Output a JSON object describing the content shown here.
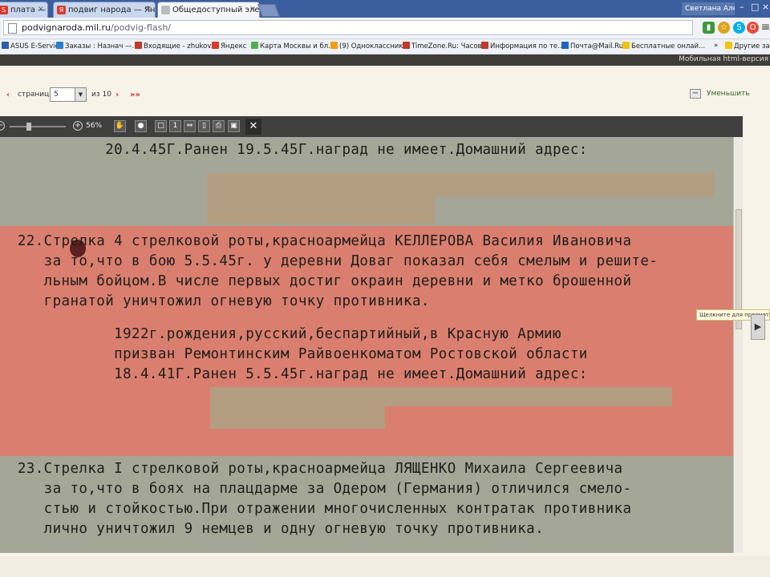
{
  "browser": {
    "tabs": [
      {
        "title": "плата — репетит",
        "icon": "S",
        "icon_color": "#d93a2b"
      },
      {
        "title": "подвиг народа — Яндекс",
        "icon": "Я",
        "icon_color": "#d93a2b"
      },
      {
        "title": "Общедоступный электрон",
        "icon": "",
        "icon_color": "#777777",
        "active": true
      }
    ],
    "user_name": "Светлана Алекс...",
    "address": {
      "host": "podvignaroda.mil.ru",
      "path": "/podvig-flash/"
    },
    "bookmarks": [
      {
        "label": "ASUS E-Service",
        "color": "#2b5bb5"
      },
      {
        "label": "Заказы : Назнач —...",
        "color": "#2a7fd4"
      },
      {
        "label": "Входящие - zhukov...",
        "color": "#c0392b"
      },
      {
        "label": "Яндекс",
        "color": "#d93a2b"
      },
      {
        "label": "Карта Москвы и бл...",
        "color": "#4caf50"
      },
      {
        "label": "(9) Одноклассники",
        "color": "#f39c12"
      },
      {
        "label": "TimeZone.Ru: Часов...",
        "color": "#c0392b"
      },
      {
        "label": "Информация по те...",
        "color": "#c0392b"
      },
      {
        "label": "Почта@Mail.Ru",
        "color": "#1e63c3"
      },
      {
        "label": "Бесплатные онлай...",
        "color": "#f1c40f"
      }
    ],
    "other_bookmarks": "Другие закладки",
    "bookmarks_more": "»"
  },
  "site": {
    "top_banner": "Мобильная html-версия"
  },
  "pager": {
    "prev": "‹",
    "label": "страница",
    "current": "5",
    "of_label": "из 10",
    "next": "›",
    "last": "»»",
    "zoom_out_label": "Уменьшить",
    "zoom_out_symbol": "−"
  },
  "viewer": {
    "zoom_percent": "56%",
    "tooltip": "Щелкните для просмотра документа",
    "next_page_symbol": "▶",
    "close_symbol": "✕"
  },
  "document": {
    "lines": [
      "            20.4.45Г.Ранен 19.5.45Г.наград не имеет.Домашний адрес:",
      "  22.Стрелка 4 стрелковой роты,красноармейца КЕЛЛЕРОВА Василия Ивановича",
      "     за то,что в бою 5.5.45г. у деревни Доваг показал себя смелым и решите-",
      "     льным бойцом.В числе первых достиг окраин деревни и метко брошенной",
      "     гранатой уничтожил огневую точку противника.",
      "             1922г.рождения,русский,беспартийный,в Красную Армию",
      "             призван Ремонтинским Райвоенкоматом Ростовской области",
      "             18.4.41Г.Ранен 5.5.45г.наград не имеет.Домашний адрес:",
      "  23.Стрелка I стрелковой роты,красноармейца ЛЯЩЕНКО Михаила Сергеевича",
      "     за то,что в боях на плацдарме за Одером (Германия) отличился смело-",
      "     стью и стойкостью.При отражении многочисленных контратак противника",
      "     лично уничтожил 9 немцев и одну огневую точку противника."
    ]
  }
}
